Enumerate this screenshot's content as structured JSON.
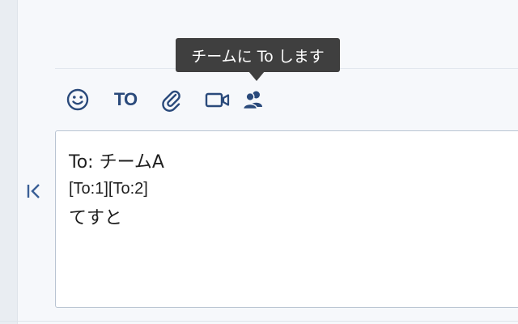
{
  "toolbar": {
    "items": [
      {
        "name": "emoji",
        "icon": "smiley-icon"
      },
      {
        "name": "to",
        "label": "TO"
      },
      {
        "name": "attach",
        "icon": "paperclip-icon"
      },
      {
        "name": "video",
        "icon": "video-camera-icon"
      },
      {
        "name": "team-to",
        "icon": "group-users-icon"
      }
    ]
  },
  "tooltip": {
    "text": "チームに To します"
  },
  "editor": {
    "lines": [
      "To: チームA",
      "[To:1][To:2]",
      "てすと"
    ]
  },
  "collapse": {
    "icon": "collapse-left-icon"
  },
  "colors": {
    "accent": "#2a4a7b",
    "tooltip_bg": "#3f3f3f",
    "editor_border": "#b9c4d2"
  }
}
